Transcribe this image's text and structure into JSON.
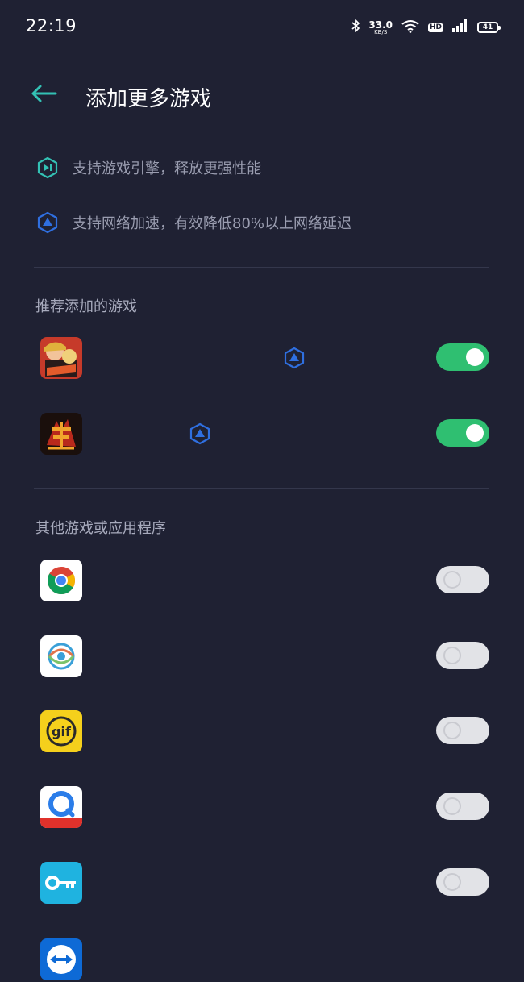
{
  "status_bar": {
    "time": "22:19",
    "net_speed": "33.0",
    "net_unit": "KB/S",
    "hd": "HD",
    "battery": "41",
    "icons": [
      "bluetooth-icon",
      "wifi-icon",
      "hd-icon",
      "signal-icon",
      "battery-icon"
    ]
  },
  "header": {
    "title": "添加更多游戏",
    "back_icon": "back-arrow-icon"
  },
  "features": [
    {
      "text": "支持游戏引擎，释放更强性能",
      "icon": "game-engine-icon"
    },
    {
      "text": "支持网络加速，有效降低80%以上网络延迟",
      "icon": "network-accel-icon"
    }
  ],
  "recommended": {
    "title": "推荐添加的游戏",
    "apps": [
      {
        "icon": "one-piece-game-icon",
        "badge": "network-accel-icon",
        "enabled": true
      },
      {
        "icon": "sanguosha-game-icon",
        "badge": "network-accel-icon",
        "enabled": true
      }
    ]
  },
  "others": {
    "title": "其他游戏或应用程序",
    "apps": [
      {
        "icon": "chrome-app-icon",
        "enabled": false
      },
      {
        "icon": "swirl-app-icon",
        "enabled": false
      },
      {
        "icon": "gif-app-icon",
        "enabled": false
      },
      {
        "icon": "browser-app-icon",
        "enabled": false
      },
      {
        "icon": "key-app-icon",
        "enabled": false
      },
      {
        "icon": "teamviewer-app-icon",
        "enabled": false
      }
    ]
  },
  "colors": {
    "background": "#1f2133",
    "accent_teal": "#33c1b4",
    "accent_blue": "#2f6fe0",
    "toggle_on": "#2fbf71",
    "toggle_off": "#e2e3e7"
  }
}
